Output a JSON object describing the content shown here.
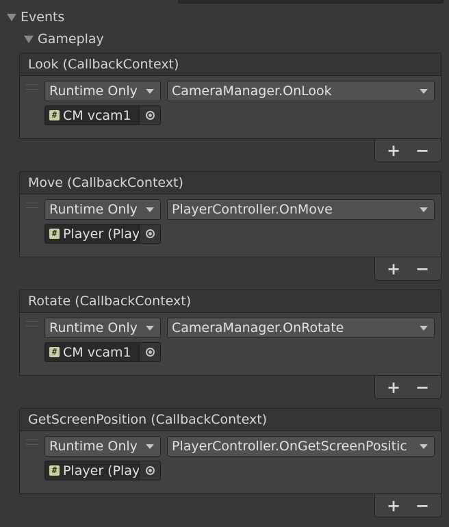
{
  "foldouts": {
    "events_label": "Events",
    "gameplay_label": "Gameplay"
  },
  "events": [
    {
      "header": "Look (CallbackContext)",
      "mode": "Runtime Only",
      "function": "CameraManager.OnLook",
      "target": "CM vcam1",
      "add_label": "+",
      "remove_label": "−"
    },
    {
      "header": "Move (CallbackContext)",
      "mode": "Runtime Only",
      "function": "PlayerController.OnMove",
      "target": "Player (Play",
      "add_label": "+",
      "remove_label": "−"
    },
    {
      "header": "Rotate (CallbackContext)",
      "mode": "Runtime Only",
      "function": "CameraManager.OnRotate",
      "target": "CM vcam1",
      "add_label": "+",
      "remove_label": "−"
    },
    {
      "header": "GetScreenPosition (CallbackContext)",
      "mode": "Runtime Only",
      "function": "PlayerController.OnGetScreenPositic",
      "target": "Player (Play",
      "add_label": "+",
      "remove_label": "−"
    }
  ],
  "icons": {
    "script": "#",
    "foldout": "triangle-down",
    "object_picker": "target-circle"
  },
  "colors": {
    "background": "#383838",
    "panel": "#414141",
    "dropdown": "#515151",
    "text": "#d2d2d2"
  }
}
